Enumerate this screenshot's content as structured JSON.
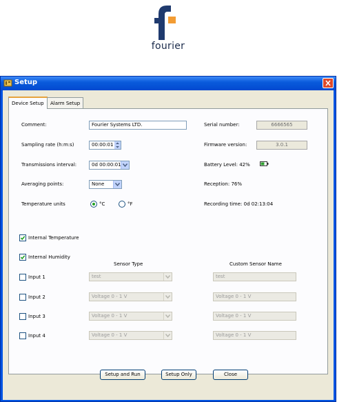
{
  "logo": {
    "text": "fourier",
    "colors": {
      "dark": "#1f3a6e",
      "accent": "#f39c33"
    }
  },
  "window": {
    "title": "Setup"
  },
  "tabs": [
    {
      "label": "Device Setup"
    },
    {
      "label": "Alarm Setup"
    }
  ],
  "form": {
    "comment_label": "Comment:",
    "comment_value": "Fourier Systems LTD.",
    "sampling_label": "Sampling rate (h:m:s)",
    "sampling_value": "00:00:01",
    "transmission_label": "Transmissions interval:",
    "transmission_value": "0d 00:00:01",
    "averaging_label": "Averaging points:",
    "averaging_value": "None",
    "temp_units_label": "Temperature units",
    "unit_c": "°C",
    "unit_f": "°F",
    "serial_label": "Serial number:",
    "serial_value": "6666565",
    "firmware_label": "Firmware version:",
    "firmware_value": "3.0.1",
    "battery_label": "Battery Level: 42%",
    "reception_label": "Reception: 76%",
    "recording_label": "Recording time: 0d 02:13:04"
  },
  "sensors": {
    "internal_temp": "Internal Temperature",
    "internal_humidity": "Internal Humidity",
    "type_header": "Sensor Type",
    "name_header": "Custom Sensor Name",
    "inputs": [
      {
        "label": "Input 1",
        "type": "test",
        "name": "test"
      },
      {
        "label": "Input 2",
        "type": "Voltage 0 - 1 V",
        "name": "Voltage 0 - 1 V"
      },
      {
        "label": "Input 3",
        "type": "Voltage 0 - 1 V",
        "name": "Voltage 0 - 1 V"
      },
      {
        "label": "Input 4",
        "type": "Voltage 0 - 1 V",
        "name": "Voltage 0 - 1 V"
      }
    ]
  },
  "buttons": {
    "setup_run": "Setup and Run",
    "setup_only": "Setup Only",
    "close": "Close"
  }
}
